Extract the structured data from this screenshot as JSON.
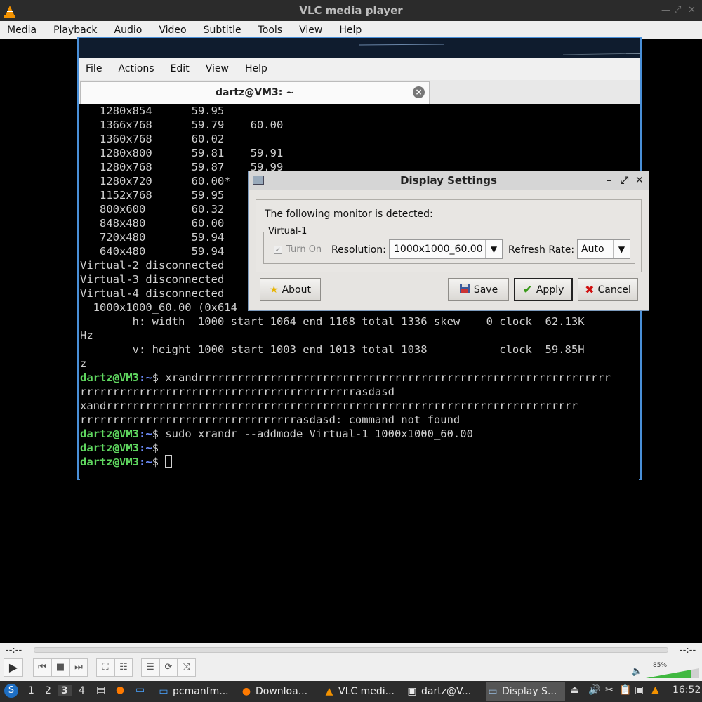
{
  "vlc": {
    "title": "VLC media player",
    "menu": [
      "Media",
      "Playback",
      "Audio",
      "Video",
      "Subtitle",
      "Tools",
      "View",
      "Help"
    ],
    "time_elapsed": "--:--",
    "time_total": "--:--",
    "volume_pct": "85%",
    "volume_level": 0.85
  },
  "terminal": {
    "menu": [
      "File",
      "Actions",
      "Edit",
      "View",
      "Help"
    ],
    "tab_title": "dartz@VM3: ~",
    "prompt_user": "dartz@VM3",
    "prompt_path": ":~",
    "lines": [
      "   1280x854      59.95",
      "   1366x768      59.79    60.00",
      "   1360x768      60.02",
      "   1280x800      59.81    59.91",
      "   1280x768      59.87    59.99",
      "   1280x720      60.00*",
      "   1152x768      59.95",
      "   800x600       60.32",
      "   848x480       60.00",
      "   720x480       59.94",
      "   640x480       59.94",
      "Virtual-2 disconnected",
      "Virtual-3 disconnected",
      "Virtual-4 disconnected",
      "  1000x1000_60.00 (0x614",
      "        h: width  1000 start 1064 end 1168 total 1336 skew    0 clock  62.13K",
      "Hz",
      "        v: height 1000 start 1003 end 1013 total 1038           clock  59.85H",
      "z"
    ],
    "cmd1": "$ xrandrrrrrrrrrrrrrrrrrrrrrrrrrrrrrrrrrrrrrrrrrrrrrrrrrrrrrrrrrrrrrrr",
    "cmd1_cont": "rrrrrrrrrrrrrrrrrrrrrrrrrrrrrrrrrrrrrrrrrrasdasd",
    "err1": "xandrrrrrrrrrrrrrrrrrrrrrrrrrrrrrrrrrrrrrrrrrrrrrrrrrrrrrrrrrrrrrrrrrrrrrrrr",
    "err2": "rrrrrrrrrrrrrrrrrrrrrrrrrrrrrrrrrasdasd: command not found",
    "cmd2": "$ sudo xrandr --addmode Virtual-1 1000x1000_60.00",
    "cmd3": "$ ",
    "cmd4": "$ "
  },
  "dialog": {
    "title": "Display Settings",
    "detected": "The following monitor is detected:",
    "monitor": "Virtual-1",
    "turn_on": "Turn On",
    "resolution_label": "Resolution:",
    "resolution_value": "1000x1000_60.00",
    "refresh_label": "Refresh Rate:",
    "refresh_value": "Auto",
    "about": "About",
    "save": "Save",
    "apply": "Apply",
    "cancel": "Cancel"
  },
  "taskbar": {
    "workspaces": [
      "1",
      "2",
      "3",
      "4"
    ],
    "windows": [
      "pcmanfm...",
      "Downloa...",
      "VLC medi...",
      "dartz@V...",
      "Display S..."
    ],
    "clock": "16:52"
  }
}
